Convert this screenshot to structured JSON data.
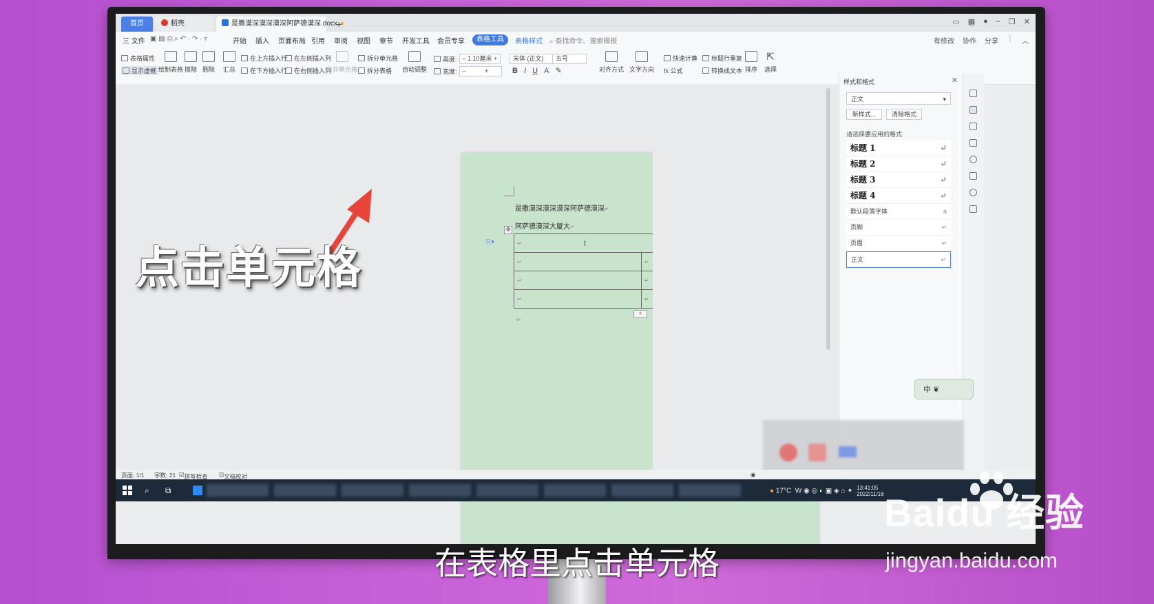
{
  "titlebar": {
    "tabs": [
      "首页",
      "稻壳",
      "是撒漠深漠深漠深阿萨德漠深.docx"
    ],
    "add_tab": "+"
  },
  "menubar": {
    "file": "三 文件",
    "items": [
      "开始",
      "插入",
      "页面布局",
      "引用",
      "审阅",
      "视图",
      "章节",
      "开发工具",
      "会员专享"
    ],
    "active": "表格工具",
    "table_style": "表格样式",
    "search": "查找命令、搜索模板",
    "right": [
      "有修改",
      "协作",
      "分享"
    ]
  },
  "ribbon": {
    "table_props": "表格属性",
    "show_grid": "显示虚框",
    "draw_table": "绘制表格",
    "erase": "擦除",
    "delete": "删除",
    "summary": "汇总",
    "insert_above": "在上方插入行",
    "insert_below": "在下方插入行",
    "insert_left": "在左侧插入列",
    "insert_right": "在右侧插入列",
    "merge_cells": "合并单元格",
    "split_cells": "拆分单元格",
    "split_table": "拆分表格",
    "auto_fit": "自动调整",
    "height_label": "高度:",
    "height_value": "1.10厘米",
    "width_label": "宽度:",
    "font_name": "宋体 (正文)",
    "font_size": "五号",
    "align": "对齐方式",
    "text_dir": "文字方向",
    "quick_calc": "快速计算",
    "repeat_header": "标题行重复",
    "formula": "fx 公式",
    "to_text": "转换成文本",
    "sort": "排序",
    "select": "选择"
  },
  "document": {
    "line1": "是撒漠深漠深漠深阿萨德漠深",
    "line2": "阿萨德漠深大厦大",
    "para_mark": "↵"
  },
  "pane": {
    "title": "样式和格式",
    "current": "正文",
    "new_style": "新样式...",
    "clear_format": "清除格式",
    "prompt": "请选择要应用的格式",
    "styles": [
      "标题 1",
      "标题 2",
      "标题 3",
      "标题 4",
      "默认段落字体",
      "页脚",
      "页眉",
      "正文"
    ]
  },
  "ime": {
    "label": "中"
  },
  "statusbar": {
    "page": "页面: 1/1",
    "words": "字数: 21",
    "spell": "拼写检查",
    "proof": "文档校对"
  },
  "taskbar": {
    "temp": "17°C",
    "time": "13:41:05",
    "date": "2022/11/16"
  },
  "annotation": {
    "callout": "点击单元格",
    "subtitle": "在表格里点击单元格"
  },
  "watermark": {
    "brand": "Baidu 经验",
    "url": "jingyan.baidu.com"
  },
  "colors": {
    "accent": "#3d7be0",
    "page_bg": "#c8e4cc",
    "arrow": "#e8443a",
    "backdrop": "#c760d8"
  }
}
